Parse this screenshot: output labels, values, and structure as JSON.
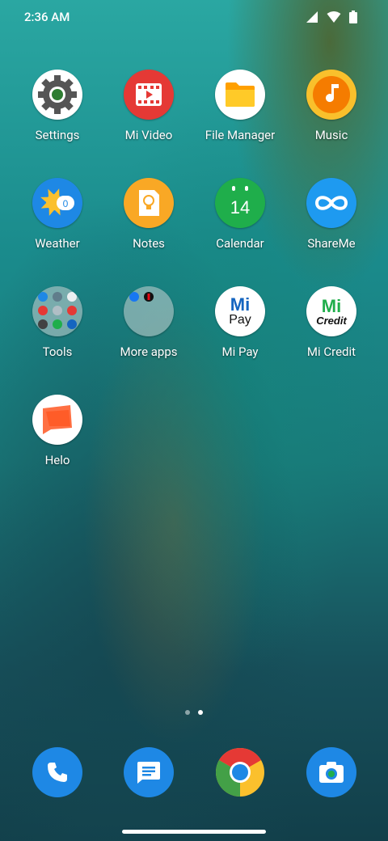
{
  "status": {
    "time": "2:36 AM"
  },
  "apps": [
    {
      "label": "Settings"
    },
    {
      "label": "Mi Video"
    },
    {
      "label": "File Manager"
    },
    {
      "label": "Music"
    },
    {
      "label": "Weather",
      "badge": "0"
    },
    {
      "label": "Notes"
    },
    {
      "label": "Calendar",
      "day": "14"
    },
    {
      "label": "ShareMe"
    },
    {
      "label": "Tools"
    },
    {
      "label": "More apps"
    },
    {
      "label": "Mi Pay",
      "icon_top": "Mi",
      "icon_bottom": "Pay"
    },
    {
      "label": "Mi Credit",
      "icon_top": "Mi",
      "icon_bottom": "Credit"
    },
    {
      "label": "Helo"
    }
  ],
  "page_indicator": {
    "pages": 2,
    "current": 1
  },
  "colors": {
    "settings_bg": "#ffffff",
    "mivideo_bg": "#e53935",
    "filemanager_bg": "#ffffff",
    "music_bg": "#f9a825",
    "weather_bg": "#1e88e5",
    "notes_bg": "#f9a825",
    "calendar_bg": "#1fae4b",
    "shareme_bg": "#1e9af0",
    "phone_bg": "#1e88e5",
    "messages_bg": "#1e88e5",
    "camera_bg": "#1e88e5"
  }
}
